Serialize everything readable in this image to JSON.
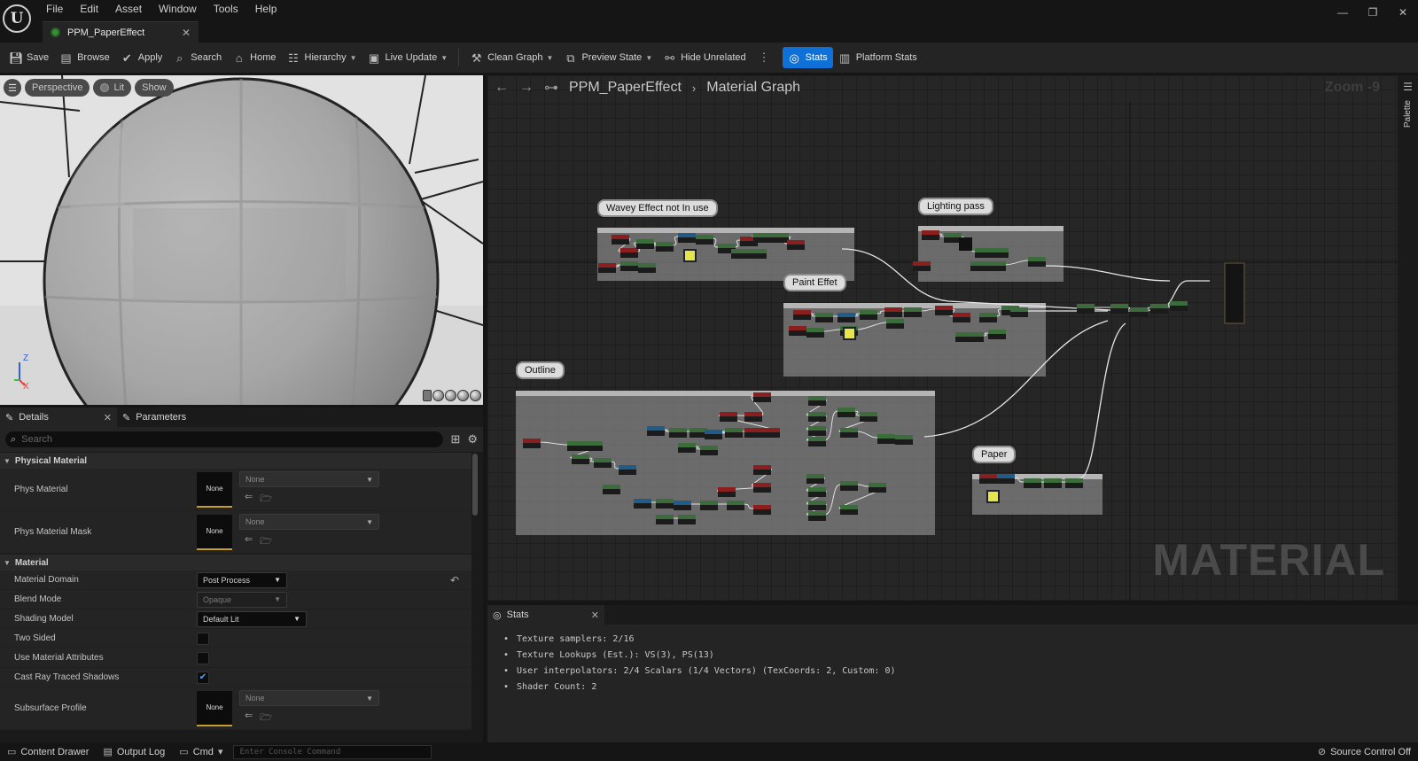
{
  "app": {
    "logo": "U",
    "menus": [
      "File",
      "Edit",
      "Asset",
      "Window",
      "Tools",
      "Help"
    ],
    "document_tab": "PPM_PaperEffect",
    "window_controls": [
      "—",
      "❐",
      "✕"
    ]
  },
  "toolbar": {
    "save": "Save",
    "browse": "Browse",
    "apply": "Apply",
    "search": "Search",
    "home": "Home",
    "hierarchy": "Hierarchy",
    "live_update": "Live Update",
    "clean_graph": "Clean Graph",
    "preview_state": "Preview State",
    "hide_unrelated": "Hide Unrelated",
    "stats": "Stats",
    "platform_stats": "Platform Stats",
    "active_color": "#0f70d7"
  },
  "viewport": {
    "view_mode": "Perspective",
    "lighting": "Lit",
    "show": "Show",
    "axis_z": "Z",
    "axis_x": "X"
  },
  "details": {
    "tabs": [
      "Details",
      "Parameters"
    ],
    "search_placeholder": "Search",
    "categories": {
      "physical_material": "Physical Material",
      "material": "Material"
    },
    "props": {
      "phys_material": {
        "label": "Phys Material",
        "thumb": "None",
        "value": "None"
      },
      "phys_material_mask": {
        "label": "Phys Material Mask",
        "thumb": "None",
        "value": "None"
      },
      "material_domain": {
        "label": "Material Domain",
        "value": "Post Process"
      },
      "blend_mode": {
        "label": "Blend Mode",
        "value": "Opaque"
      },
      "shading_model": {
        "label": "Shading Model",
        "value": "Default Lit"
      },
      "two_sided": {
        "label": "Two Sided",
        "checked": false
      },
      "use_material_attributes": {
        "label": "Use Material Attributes",
        "checked": false
      },
      "cast_ray_traced_shadows": {
        "label": "Cast Ray Traced Shadows",
        "checked": true
      },
      "subsurface_profile": {
        "label": "Subsurface Profile",
        "thumb": "None",
        "value": "None"
      }
    }
  },
  "graph": {
    "breadcrumb_asset": "PPM_PaperEffect",
    "breadcrumb_graph": "Material Graph",
    "zoom": "Zoom -9",
    "watermark": "MATERIAL",
    "comments": [
      "Wavey Effect not In use",
      "Lighting pass",
      "Paint Effet",
      "Outline",
      "Paper"
    ],
    "palette_label": "Palette"
  },
  "stats": {
    "tab": "Stats",
    "lines": [
      "Texture samplers: 2/16",
      "Texture Lookups (Est.): VS(3), PS(13)",
      "User interpolators: 2/4 Scalars (1/4 Vectors) (TexCoords: 2, Custom: 0)",
      "Shader Count: 2"
    ]
  },
  "statusbar": {
    "content_drawer": "Content Drawer",
    "output_log": "Output Log",
    "cmd": "Cmd",
    "console_placeholder": "Enter Console Command",
    "source_control": "Source Control Off"
  }
}
